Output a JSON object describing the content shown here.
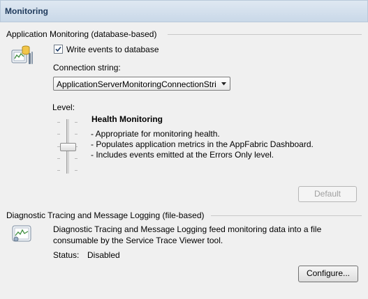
{
  "header": {
    "title": "Monitoring"
  },
  "app_monitoring": {
    "group_title": "Application Monitoring (database-based)",
    "write_events_label": "Write events to database",
    "write_events_checked": true,
    "connection_label": "Connection string:",
    "connection_value": "ApplicationServerMonitoringConnectionStri",
    "level_label": "Level:",
    "level_title": "Health Monitoring",
    "level_bullets": [
      "- Appropriate for monitoring health.",
      "- Populates application metrics in the AppFabric Dashboard.",
      "- Includes events emitted at the Errors Only level."
    ],
    "default_button": "Default"
  },
  "diagnostic": {
    "group_title": "Diagnostic Tracing and Message Logging (file-based)",
    "description_line1": "Diagnostic Tracing and Message Logging feed monitoring data into a file",
    "description_line2": "consumable by the Service Trace Viewer tool.",
    "status_label": "Status:",
    "status_value": "Disabled",
    "configure_button": "Configure..."
  },
  "icons": {
    "app_monitoring": "database-monitoring-icon",
    "diagnostic": "trace-log-icon",
    "dropdown": "chevron-down-icon",
    "check": "check-icon"
  }
}
